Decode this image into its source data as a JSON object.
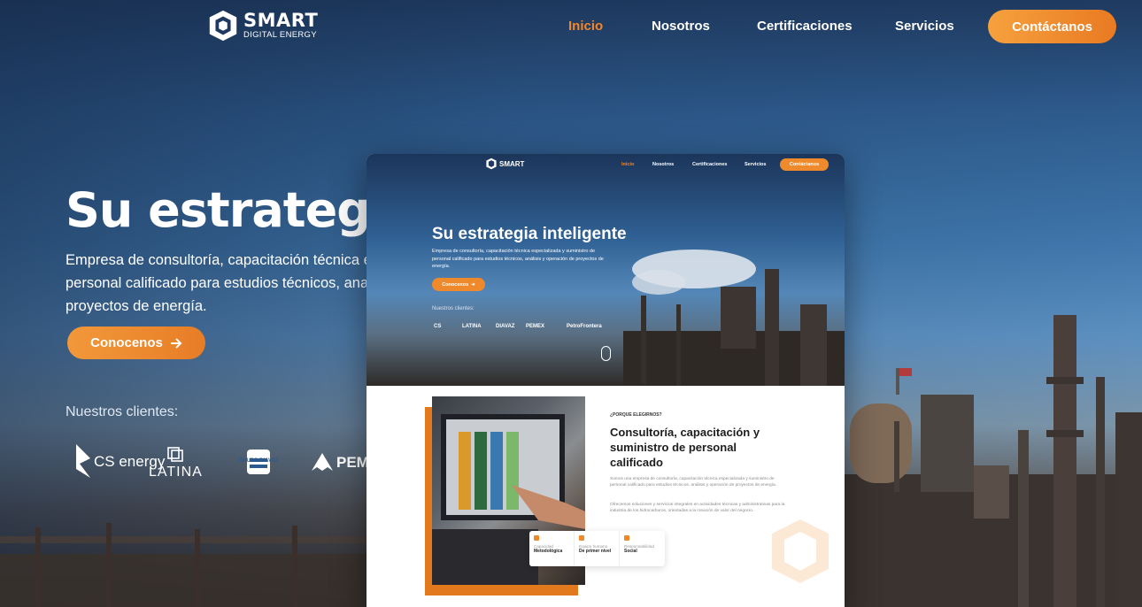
{
  "brand": {
    "name": "SMART",
    "tagline": "DIGITAL ENERGY"
  },
  "nav": {
    "items": [
      {
        "label": "Inicio",
        "active": true
      },
      {
        "label": "Nosotros"
      },
      {
        "label": "Certificaciones"
      },
      {
        "label": "Servicios"
      }
    ],
    "contact_label": "Contáctanos"
  },
  "hero": {
    "title": "Su estrategia",
    "description_lines": [
      "Empresa de consultoría, capacitación técnica esp",
      "personal calificado para estudios técnicos, analisi",
      "proyectos de energía."
    ],
    "cta_label": "Conocenos",
    "clients_label": "Nuestros clientes:",
    "clients": [
      "CS energy",
      "LATINA",
      "GRUPO DIAVAZ",
      "PEM"
    ]
  },
  "preview": {
    "nav": {
      "items": [
        "Inicio",
        "Nosotros",
        "Certificaciones",
        "Servicios"
      ],
      "contact_label": "Contáctanos"
    },
    "title": "Su estrategia inteligente",
    "description": "Empresa de consultoría, capacitación técnica especializada y suministro de personal calificado para estudios técnicos, análisis y operación de proyectos de energía.",
    "cta_label": "Conocenos",
    "clients_label": "Nuestros clientes:",
    "clients": [
      "CS",
      "LATINA",
      "DIAVAZ",
      "PEMEX",
      "PetroFrontera"
    ],
    "kicker": "¿PORQUE ELEGIRNOS?",
    "heading": "Consultoría, capacitación y suministro de personal calificado",
    "paragraph1": "Somos una empresa de consultoría, capacitación técnica especializada y suministro de personal calificado para estudios técnicos, análisis y operación de proyectos de energía.",
    "paragraph2": "Ofrecemos soluciones y servicios integrales en actividades técnicas y administrativas para la industria de los hidrocarburos, orientadas a la creación de valor del negocio.",
    "features": [
      {
        "top": "Capacidad",
        "bottom": "Metodológica"
      },
      {
        "top": "Equipo humano",
        "bottom": "De primer nivel"
      },
      {
        "top": "Responsabilidad",
        "bottom": "Social"
      }
    ]
  },
  "colors": {
    "accent": "#ee8a2c",
    "nav_bg": "#1f3a60"
  }
}
